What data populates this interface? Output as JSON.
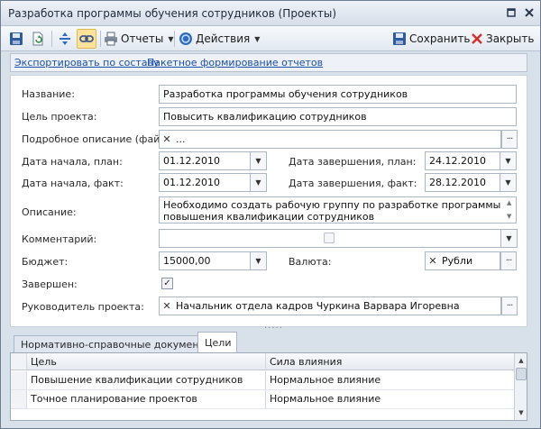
{
  "window": {
    "title": "Разработка программы обучения сотрудников (Проекты)"
  },
  "toolbar": {
    "reports_label": "Отчеты",
    "actions_label": "Действия",
    "save_label": "Сохранить",
    "close_label": "Закрыть"
  },
  "links": {
    "export": "Экспортировать по составу",
    "batch_reports": "Пакетное формирование отчетов"
  },
  "form": {
    "name_label": "Название:",
    "name_value": "Разработка программы обучения сотрудников",
    "goal_label": "Цель проекта:",
    "goal_value": "Повысить квалификацию сотрудников",
    "file_label": "Подробное описание (файл):",
    "file_value": "...",
    "start_plan_label": "Дата начала, план:",
    "start_plan_value": "01.12.2010",
    "end_plan_label": "Дата завершения, план:",
    "end_plan_value": "24.12.2010",
    "start_fact_label": "Дата начала, факт:",
    "start_fact_value": "01.12.2010",
    "end_fact_label": "Дата завершения, факт:",
    "end_fact_value": "28.12.2010",
    "description_label": "Описание:",
    "description_line1": "Необходимо создать рабочую группу по разработке программы",
    "description_line2": "повышения квалификации сотрудников",
    "comment_label": "Комментарий:",
    "comment_value": "",
    "budget_label": "Бюджет:",
    "budget_value": "15000,00",
    "currency_label": "Валюта:",
    "currency_value": "Рубли",
    "completed_label": "Завершен:",
    "completed_checked": true,
    "manager_label": "Руководитель проекта:",
    "manager_value": "Начальник отдела кадров Чуркина Варвара Игоревна"
  },
  "tabs": [
    {
      "label": "Нормативно-справочные документы",
      "active": false
    },
    {
      "label": "Цели",
      "active": true
    }
  ],
  "grid": {
    "columns": [
      "Цель",
      "Сила влияния"
    ],
    "rows": [
      [
        "Повышение квалификации сотрудников",
        "Нормальное влияние"
      ],
      [
        "Точное планирование проектов",
        "Нормальное влияние"
      ]
    ]
  },
  "colors": {
    "accent": "#1a4fa8",
    "window_bg": "#d8e0ea",
    "active_tool": "#ffe29a"
  }
}
